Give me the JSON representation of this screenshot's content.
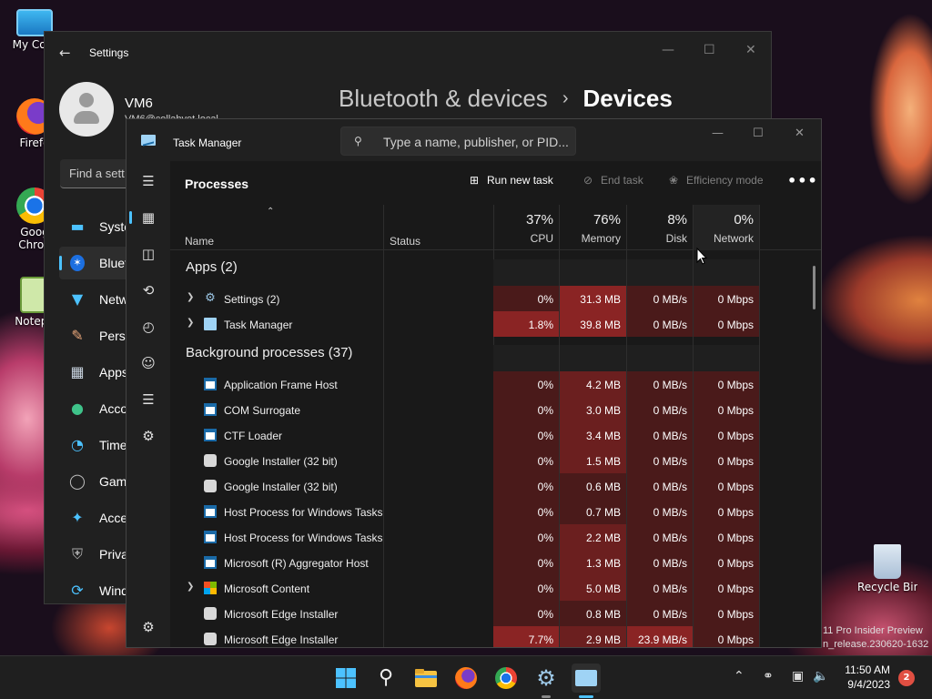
{
  "desktop": {
    "icons": [
      {
        "label": "My Com",
        "icon": "monitor-icon"
      },
      {
        "label": "Firefo",
        "icon": "firefox-icon"
      },
      {
        "label": "Goog Chron",
        "icon": "chrome-icon"
      },
      {
        "label": "Notepa",
        "icon": "notepad-icon"
      },
      {
        "label": "Recycle Bin",
        "icon": "recycle-bin-icon"
      }
    ],
    "watermark": [
      "11 Pro Insider Preview",
      "n_release.230620-1632"
    ]
  },
  "settings": {
    "title": "Settings",
    "user_name": "VM6",
    "user_email": "VM6@collabvet.local",
    "breadcrumb": [
      "Bluetooth & devices",
      "Devices"
    ],
    "search_placeholder": "Find a sett",
    "nav": [
      {
        "label": "Syste",
        "icon": "system-icon"
      },
      {
        "label": "Bluet",
        "icon": "bluetooth-icon",
        "active": true
      },
      {
        "label": "Netw",
        "icon": "network-icon"
      },
      {
        "label": "Perso",
        "icon": "personalization-icon"
      },
      {
        "label": "Apps",
        "icon": "apps-icon"
      },
      {
        "label": "Acco",
        "icon": "accounts-icon"
      },
      {
        "label": "Time",
        "icon": "time-icon"
      },
      {
        "label": "Gam",
        "icon": "gaming-icon"
      },
      {
        "label": "Acce",
        "icon": "accessibility-icon"
      },
      {
        "label": "Priva",
        "icon": "privacy-icon"
      },
      {
        "label": "Wind",
        "icon": "windows-update-icon"
      }
    ]
  },
  "taskmanager": {
    "title": "Task Manager",
    "search_placeholder": "Type a name, publisher, or PID...",
    "page_title": "Processes",
    "toolbar": {
      "run_new_task": "Run new task",
      "end_task": "End task",
      "efficiency_mode": "Efficiency mode",
      "more": "•••"
    },
    "columns": {
      "name": "Name",
      "status": "Status",
      "cpu": {
        "pct": "37%",
        "label": "CPU"
      },
      "memory": {
        "pct": "76%",
        "label": "Memory"
      },
      "disk": {
        "pct": "8%",
        "label": "Disk"
      },
      "network": {
        "pct": "0%",
        "label": "Network"
      }
    },
    "groups": {
      "apps": "Apps (2)",
      "background": "Background processes (37)"
    },
    "apps": [
      {
        "name": "Settings (2)",
        "icon": "gear",
        "expandable": true,
        "cpu": "0%",
        "memory": "31.3 MB",
        "disk": "0 MB/s",
        "network": "0 Mbps"
      },
      {
        "name": "Task Manager",
        "icon": "tmi",
        "expandable": true,
        "cpu": "1.8%",
        "memory": "39.8 MB",
        "disk": "0 MB/s",
        "network": "0 Mbps"
      }
    ],
    "background": [
      {
        "name": "Application Frame Host",
        "icon": "win",
        "expandable": false,
        "cpu": "0%",
        "memory": "4.2 MB",
        "disk": "0 MB/s",
        "network": "0 Mbps"
      },
      {
        "name": "COM Surrogate",
        "icon": "win",
        "expandable": false,
        "cpu": "0%",
        "memory": "3.0 MB",
        "disk": "0 MB/s",
        "network": "0 Mbps"
      },
      {
        "name": "CTF Loader",
        "icon": "win",
        "expandable": false,
        "cpu": "0%",
        "memory": "3.4 MB",
        "disk": "0 MB/s",
        "network": "0 Mbps"
      },
      {
        "name": "Google Installer (32 bit)",
        "icon": "inst",
        "expandable": false,
        "cpu": "0%",
        "memory": "1.5 MB",
        "disk": "0 MB/s",
        "network": "0 Mbps"
      },
      {
        "name": "Google Installer (32 bit)",
        "icon": "inst",
        "expandable": false,
        "cpu": "0%",
        "memory": "0.6 MB",
        "disk": "0 MB/s",
        "network": "0 Mbps"
      },
      {
        "name": "Host Process for Windows Tasks",
        "icon": "win",
        "expandable": false,
        "cpu": "0%",
        "memory": "0.7 MB",
        "disk": "0 MB/s",
        "network": "0 Mbps"
      },
      {
        "name": "Host Process for Windows Tasks",
        "icon": "win",
        "expandable": false,
        "cpu": "0%",
        "memory": "2.2 MB",
        "disk": "0 MB/s",
        "network": "0 Mbps"
      },
      {
        "name": "Microsoft (R) Aggregator Host",
        "icon": "win",
        "expandable": false,
        "cpu": "0%",
        "memory": "1.3 MB",
        "disk": "0 MB/s",
        "network": "0 Mbps"
      },
      {
        "name": "Microsoft Content",
        "icon": "ms",
        "expandable": true,
        "cpu": "0%",
        "memory": "5.0 MB",
        "disk": "0 MB/s",
        "network": "0 Mbps"
      },
      {
        "name": "Microsoft Edge Installer",
        "icon": "inst",
        "expandable": false,
        "cpu": "0%",
        "memory": "0.8 MB",
        "disk": "0 MB/s",
        "network": "0 Mbps"
      },
      {
        "name": "Microsoft Edge Installer",
        "icon": "inst",
        "expandable": false,
        "cpu": "7.7%",
        "memory": "2.9 MB",
        "disk": "23.9 MB/s",
        "network": "0 Mbps"
      }
    ],
    "heat_colors": {
      "low": "#4a1a1a",
      "mid": "#6b1f1f",
      "high": "#8a2424",
      "none": "#1f1f1f"
    }
  },
  "taskbar": {
    "apps": [
      "start-icon",
      "search-icon",
      "file-explorer-icon",
      "firefox-icon",
      "chrome-icon",
      "settings-icon",
      "task-manager-icon"
    ],
    "time": "11:50 AM",
    "date": "9/4/2023",
    "notification_count": "2"
  }
}
